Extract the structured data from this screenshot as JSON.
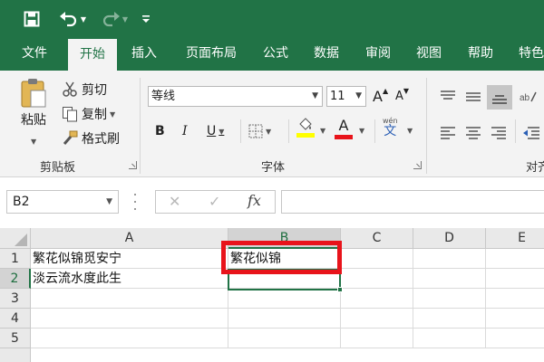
{
  "tabs": [
    "文件",
    "开始",
    "插入",
    "页面布局",
    "公式",
    "数据",
    "审阅",
    "视图",
    "帮助",
    "特色"
  ],
  "active_tab": "开始",
  "clipboard": {
    "paste_label": "粘贴",
    "cut_label": "剪切",
    "copy_label": "复制",
    "format_painter_label": "格式刷",
    "group_label": "剪贴板"
  },
  "font": {
    "font_name": "等线",
    "font_size": "11",
    "bold": "B",
    "italic": "I",
    "underline": "U",
    "grow_font": "A",
    "shrink_font": "A",
    "font_color_letter": "A",
    "phonetic_glyph": "文",
    "phonetic_top": "wén",
    "group_label": "字体"
  },
  "alignment": {
    "group_label": "对齐"
  },
  "formula_bar": {
    "name_box": "B2",
    "fx": "fx",
    "cancel_glyph": "✕",
    "enter_glyph": "✓",
    "value": ""
  },
  "grid": {
    "columns": [
      "A",
      "B",
      "C",
      "D",
      "E"
    ],
    "rows": [
      "1",
      "2",
      "3",
      "4",
      "5"
    ],
    "cells": {
      "A1": "繁花似锦觅安宁",
      "A2": "淡云流水度此生",
      "B1": "繁花似锦"
    },
    "selected_cell": "B2"
  },
  "colors": {
    "brand_green": "#217346",
    "highlight_red": "#e8141b",
    "font_color_bar": "#e8141b",
    "fill_color_bar": "#ffff00"
  }
}
